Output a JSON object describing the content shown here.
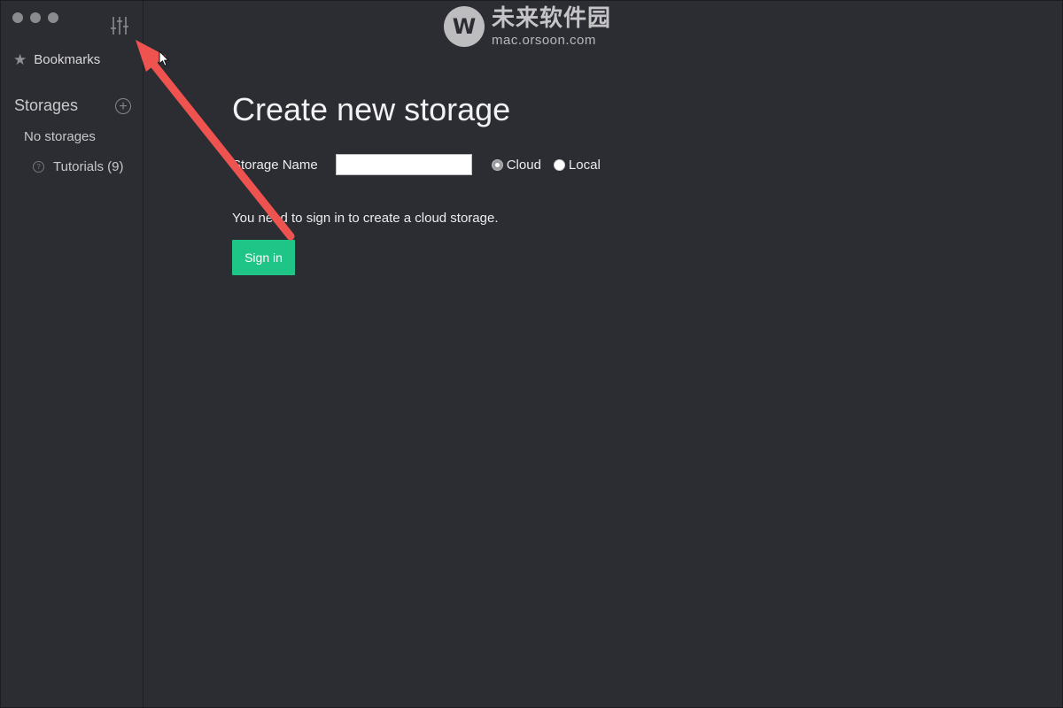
{
  "watermark": {
    "logo_letter": "W",
    "chinese": "未来软件园",
    "url": "mac.orsoon.com"
  },
  "sidebar": {
    "bookmarks_label": "Bookmarks",
    "bookmarks_icon": "star-icon",
    "storages_title": "Storages",
    "add_icon": "plus-circle-icon",
    "no_storages": "No storages",
    "tutorials_label": "Tutorials (9)",
    "tutorials_icon": "question-circle-icon",
    "preferences_icon": "sliders-icon"
  },
  "main": {
    "title": "Create new storage",
    "storage_name_label": "Storage Name",
    "storage_name_value": "",
    "radio_cloud": "Cloud",
    "radio_local": "Local",
    "selected_type": "Cloud",
    "signin_message": "You need to sign in to create a cloud storage.",
    "signin_button": "Sign in"
  },
  "colors": {
    "background": "#2c2d32",
    "accent": "#1ec587",
    "annotation_arrow": "#ef5350"
  }
}
